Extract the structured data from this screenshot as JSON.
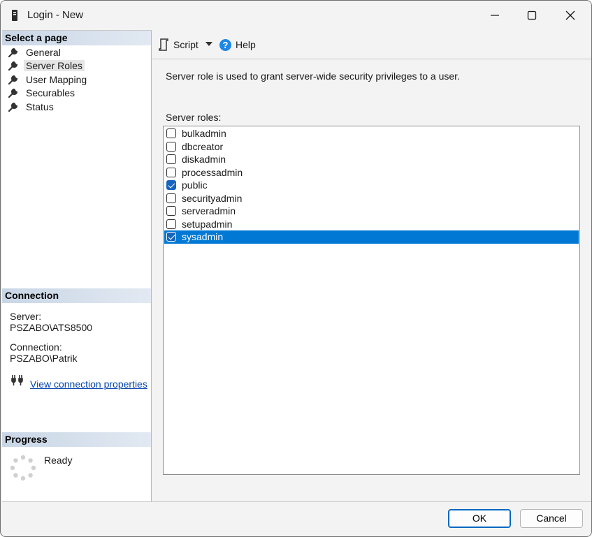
{
  "window": {
    "title": "Login - New"
  },
  "left": {
    "select_header": "Select a page",
    "pages": [
      {
        "label": "General"
      },
      {
        "label": "Server Roles",
        "selected": true
      },
      {
        "label": "User Mapping"
      },
      {
        "label": "Securables"
      },
      {
        "label": "Status"
      }
    ],
    "connection_header": "Connection",
    "server_label": "Server:",
    "server_value": "PSZABO\\ATS8500",
    "connection_label": "Connection:",
    "connection_value": "PSZABO\\Patrik",
    "view_link": "View connection properties",
    "progress_header": "Progress",
    "progress_status": "Ready"
  },
  "toolbar": {
    "script_label": "Script",
    "help_label": "Help"
  },
  "main": {
    "description": "Server role is used to grant server-wide security privileges to a user.",
    "roles_label": "Server roles:",
    "roles": [
      {
        "name": "bulkadmin",
        "checked": false,
        "selected": false
      },
      {
        "name": "dbcreator",
        "checked": false,
        "selected": false
      },
      {
        "name": "diskadmin",
        "checked": false,
        "selected": false
      },
      {
        "name": "processadmin",
        "checked": false,
        "selected": false
      },
      {
        "name": "public",
        "checked": true,
        "selected": false
      },
      {
        "name": "securityadmin",
        "checked": false,
        "selected": false
      },
      {
        "name": "serveradmin",
        "checked": false,
        "selected": false
      },
      {
        "name": "setupadmin",
        "checked": false,
        "selected": false
      },
      {
        "name": "sysadmin",
        "checked": true,
        "selected": true
      }
    ]
  },
  "buttons": {
    "ok": "OK",
    "cancel": "Cancel"
  },
  "colors": {
    "accent": "#0078d4",
    "checkbox": "#1565c0",
    "link": "#0645ad",
    "header_gradient": "#c9d6e6"
  }
}
